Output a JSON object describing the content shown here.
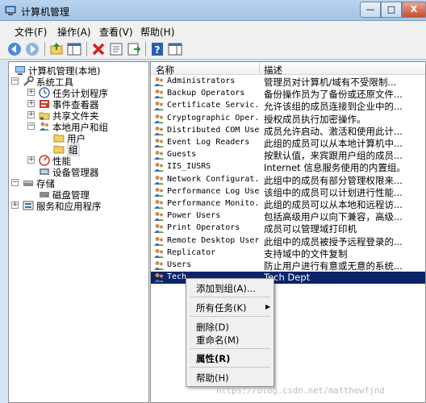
{
  "window": {
    "title": "计算机管理",
    "min_label": "—",
    "max_label": "□",
    "close_label": "X"
  },
  "menu": [
    {
      "label": "文件(F)"
    },
    {
      "label": "操作(A)"
    },
    {
      "label": "查看(V)"
    },
    {
      "label": "帮助(H)"
    }
  ],
  "toolbar": {
    "icons": [
      "back-icon",
      "forward-icon",
      "up-icon",
      "show-tree-icon",
      "delete-icon",
      "properties-icon",
      "export-icon",
      "help-icon",
      "action-pane-icon"
    ]
  },
  "tree": {
    "root": "计算机管理(本地)",
    "system_tools": "系统工具",
    "task_scheduler": "任务计划程序",
    "event_viewer": "事件查看器",
    "shared_folders": "共享文件夹",
    "local_users_groups": "本地用户和组",
    "users": "用户",
    "groups": "组",
    "performance": "性能",
    "device_manager": "设备管理器",
    "storage": "存储",
    "disk_management": "磁盘管理",
    "services_apps": "服务和应用程序"
  },
  "list": {
    "col_name": "名称",
    "col_desc": "描述",
    "rows": [
      {
        "name": "Administrators",
        "desc": "管理员对计算机/域有不受限制..."
      },
      {
        "name": "Backup Operators",
        "desc": "备份操作员为了备份或还原文件..."
      },
      {
        "name": "Certificate Servic...",
        "desc": "允许该组的成员连接到企业中的..."
      },
      {
        "name": "Cryptographic Oper...",
        "desc": "授权成员执行加密操作。"
      },
      {
        "name": "Distributed COM Users",
        "desc": "成员允许启动、激活和使用此计..."
      },
      {
        "name": "Event Log Readers",
        "desc": "此组的成员可以从本地计算机中..."
      },
      {
        "name": "Guests",
        "desc": "按默认值，来宾跟用户组的成员..."
      },
      {
        "name": "IIS_IUSRS",
        "desc": "Internet 信息服务使用的内置组。"
      },
      {
        "name": "Network Configurat...",
        "desc": "此组中的成员有部分管理权限来..."
      },
      {
        "name": "Performance Log Users",
        "desc": "该组中的成员可以计划进行性能..."
      },
      {
        "name": "Performance Monito...",
        "desc": "此组的成员可以从本地和远程访..."
      },
      {
        "name": "Power Users",
        "desc": "包括高级用户以向下兼容，高级..."
      },
      {
        "name": "Print Operators",
        "desc": "成员可以管理域打印机"
      },
      {
        "name": "Remote Desktop Users",
        "desc": "此组中的成员被授予远程登录的..."
      },
      {
        "name": "Replicator",
        "desc": "支持域中的文件复制"
      },
      {
        "name": "Users",
        "desc": "防止用户进行有意或无意的系统..."
      },
      {
        "name": "Tech",
        "desc": "Tech Dept"
      }
    ]
  },
  "context_menu": {
    "add_to_group": "添加到组(A)...",
    "all_tasks": "所有任务(K)",
    "delete": "删除(D)",
    "rename": "重命名(M)",
    "properties": "属性(R)",
    "help": "帮助(H)"
  },
  "watermark": "https://blog.csdn.net/matthewfjnd"
}
